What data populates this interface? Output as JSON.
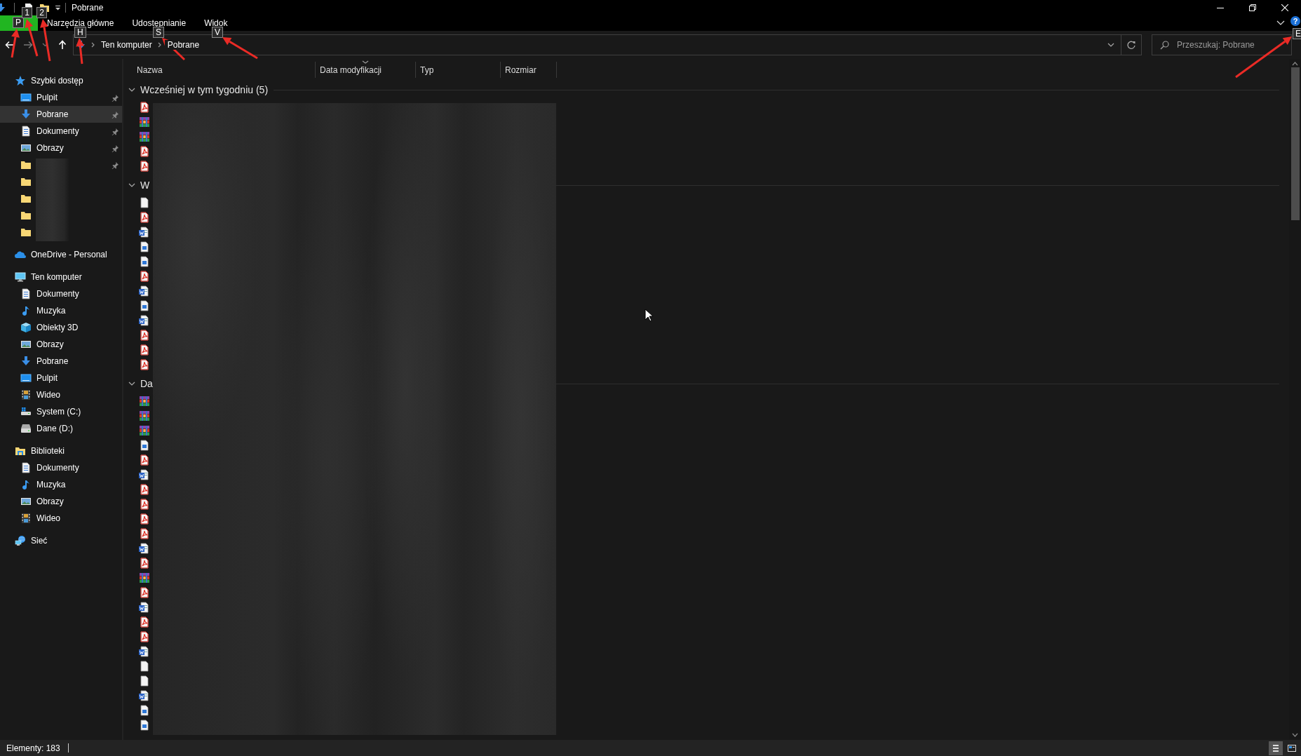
{
  "title_bar": {
    "title": "Pobrane"
  },
  "ribbon": {
    "tabs": [
      {
        "label": "Narzędzia główne",
        "selected": false
      },
      {
        "label": "Udostępnianie",
        "selected": false
      },
      {
        "label": "Widok",
        "selected": false
      }
    ],
    "help": "?"
  },
  "keytips": [
    {
      "key": "P",
      "arrow": true
    },
    {
      "key": "1",
      "arrow": true
    },
    {
      "key": "2",
      "arrow": true
    },
    {
      "key": "H",
      "arrow": true
    },
    {
      "key": "S",
      "arrow": true
    },
    {
      "key": "V",
      "arrow": true
    },
    {
      "key": "E",
      "arrow": true
    }
  ],
  "address_bar": {
    "path": [
      "Ten komputer",
      "Pobrane"
    ]
  },
  "search": {
    "placeholder": "Przeszukaj: Pobrane"
  },
  "sidebar": {
    "sections": [
      {
        "label": "Szybki dostęp",
        "kind": "star",
        "selected": false,
        "children": [
          {
            "label": "Pulpit",
            "kind": "desktop",
            "pinned": true,
            "selected": false
          },
          {
            "label": "Pobrane",
            "kind": "download",
            "pinned": true,
            "selected": true
          },
          {
            "label": "Dokumenty",
            "kind": "documents",
            "pinned": true,
            "selected": false
          },
          {
            "label": "Obrazy",
            "kind": "pictures",
            "pinned": true,
            "selected": false
          },
          {
            "kind": "folder",
            "pinned": true,
            "selected": false
          },
          {
            "kind": "folder",
            "pinned": false,
            "selected": false
          },
          {
            "kind": "folder",
            "pinned": false,
            "selected": false
          },
          {
            "kind": "folder",
            "pinned": false,
            "selected": false
          },
          {
            "kind": "folder",
            "pinned": false,
            "selected": false
          }
        ]
      },
      {
        "label": "OneDrive - Personal",
        "kind": "onedrive",
        "selected": false
      },
      {
        "label": "Ten komputer",
        "kind": "computer",
        "selected": false,
        "children": [
          {
            "label": "Dokumenty",
            "kind": "documents",
            "pinned": false,
            "selected": false
          },
          {
            "label": "Muzyka",
            "kind": "music",
            "pinned": false,
            "selected": false
          },
          {
            "label": "Obiekty 3D",
            "kind": "objects3d",
            "pinned": false,
            "selected": false
          },
          {
            "label": "Obrazy",
            "kind": "pictures",
            "pinned": false,
            "selected": false
          },
          {
            "label": "Pobrane",
            "kind": "download",
            "pinned": false,
            "selected": false
          },
          {
            "label": "Pulpit",
            "kind": "desktop",
            "pinned": false,
            "selected": false
          },
          {
            "label": "Wideo",
            "kind": "video",
            "pinned": false,
            "selected": false
          },
          {
            "label": "System (C:)",
            "kind": "drive-system",
            "pinned": false,
            "selected": false
          },
          {
            "label": "Dane (D:)",
            "kind": "drive",
            "pinned": false,
            "selected": false
          }
        ]
      },
      {
        "label": "Biblioteki",
        "kind": "library",
        "selected": false,
        "children": [
          {
            "label": "Dokumenty",
            "kind": "documents",
            "pinned": false,
            "selected": false
          },
          {
            "label": "Muzyka",
            "kind": "music",
            "pinned": false,
            "selected": false
          },
          {
            "label": "Obrazy",
            "kind": "pictures",
            "pinned": false,
            "selected": false
          },
          {
            "label": "Wideo",
            "kind": "video",
            "pinned": false,
            "selected": false
          }
        ]
      },
      {
        "label": "Sieć",
        "kind": "network",
        "selected": false
      }
    ]
  },
  "columns": [
    {
      "label": "Nazwa",
      "sorted": false
    },
    {
      "label": "Data modyfikacji",
      "sorted": true
    },
    {
      "label": "Typ",
      "sorted": false
    },
    {
      "label": "Rozmiar",
      "sorted": false
    }
  ],
  "groups": [
    {
      "title": "Wcześniej w tym tygodniu (5)",
      "expanded": true,
      "files": [
        {
          "kind": "pdf"
        },
        {
          "kind": "archive"
        },
        {
          "kind": "archive"
        },
        {
          "kind": "pdf"
        },
        {
          "kind": "pdf"
        }
      ]
    },
    {
      "title": "W",
      "expanded": true,
      "files": [
        {
          "kind": "blank"
        },
        {
          "kind": "pdf"
        },
        {
          "kind": "word"
        },
        {
          "kind": "image"
        },
        {
          "kind": "image"
        },
        {
          "kind": "pdf"
        },
        {
          "kind": "word"
        },
        {
          "kind": "image"
        },
        {
          "kind": "word"
        },
        {
          "kind": "pdf"
        },
        {
          "kind": "pdf"
        },
        {
          "kind": "pdf"
        }
      ]
    },
    {
      "title": "Da",
      "expanded": true,
      "files": [
        {
          "kind": "archive"
        },
        {
          "kind": "archive"
        },
        {
          "kind": "archive"
        },
        {
          "kind": "image"
        },
        {
          "kind": "pdf"
        },
        {
          "kind": "word"
        },
        {
          "kind": "pdf"
        },
        {
          "kind": "pdf"
        },
        {
          "kind": "pdf"
        },
        {
          "kind": "pdf"
        },
        {
          "kind": "word"
        },
        {
          "kind": "pdf"
        },
        {
          "kind": "archive"
        },
        {
          "kind": "pdf"
        },
        {
          "kind": "word"
        },
        {
          "kind": "pdf"
        },
        {
          "kind": "pdf"
        },
        {
          "kind": "word"
        },
        {
          "kind": "blank"
        },
        {
          "kind": "blank"
        },
        {
          "kind": "word"
        },
        {
          "kind": "image"
        },
        {
          "kind": "image"
        }
      ]
    }
  ],
  "status_bar": {
    "text": "Elementy: 183",
    "views": [
      {
        "kind": "details",
        "selected": true
      },
      {
        "kind": "tiles",
        "selected": false
      }
    ]
  }
}
